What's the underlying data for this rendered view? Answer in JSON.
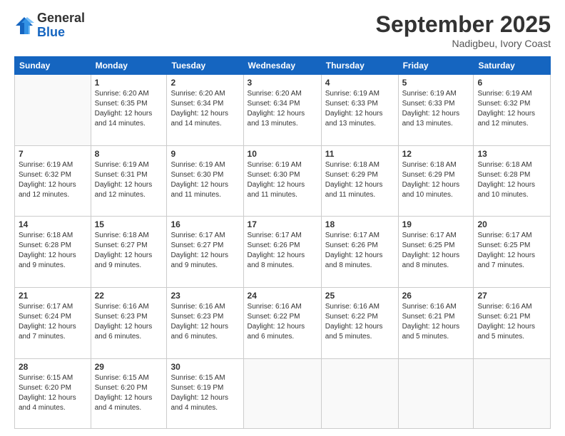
{
  "logo": {
    "general": "General",
    "blue": "Blue"
  },
  "header": {
    "month": "September 2025",
    "location": "Nadigbeu, Ivory Coast"
  },
  "weekdays": [
    "Sunday",
    "Monday",
    "Tuesday",
    "Wednesday",
    "Thursday",
    "Friday",
    "Saturday"
  ],
  "weeks": [
    [
      {
        "day": "",
        "info": ""
      },
      {
        "day": "1",
        "info": "Sunrise: 6:20 AM\nSunset: 6:35 PM\nDaylight: 12 hours\nand 14 minutes."
      },
      {
        "day": "2",
        "info": "Sunrise: 6:20 AM\nSunset: 6:34 PM\nDaylight: 12 hours\nand 14 minutes."
      },
      {
        "day": "3",
        "info": "Sunrise: 6:20 AM\nSunset: 6:34 PM\nDaylight: 12 hours\nand 13 minutes."
      },
      {
        "day": "4",
        "info": "Sunrise: 6:19 AM\nSunset: 6:33 PM\nDaylight: 12 hours\nand 13 minutes."
      },
      {
        "day": "5",
        "info": "Sunrise: 6:19 AM\nSunset: 6:33 PM\nDaylight: 12 hours\nand 13 minutes."
      },
      {
        "day": "6",
        "info": "Sunrise: 6:19 AM\nSunset: 6:32 PM\nDaylight: 12 hours\nand 12 minutes."
      }
    ],
    [
      {
        "day": "7",
        "info": "Sunrise: 6:19 AM\nSunset: 6:32 PM\nDaylight: 12 hours\nand 12 minutes."
      },
      {
        "day": "8",
        "info": "Sunrise: 6:19 AM\nSunset: 6:31 PM\nDaylight: 12 hours\nand 12 minutes."
      },
      {
        "day": "9",
        "info": "Sunrise: 6:19 AM\nSunset: 6:30 PM\nDaylight: 12 hours\nand 11 minutes."
      },
      {
        "day": "10",
        "info": "Sunrise: 6:19 AM\nSunset: 6:30 PM\nDaylight: 12 hours\nand 11 minutes."
      },
      {
        "day": "11",
        "info": "Sunrise: 6:18 AM\nSunset: 6:29 PM\nDaylight: 12 hours\nand 11 minutes."
      },
      {
        "day": "12",
        "info": "Sunrise: 6:18 AM\nSunset: 6:29 PM\nDaylight: 12 hours\nand 10 minutes."
      },
      {
        "day": "13",
        "info": "Sunrise: 6:18 AM\nSunset: 6:28 PM\nDaylight: 12 hours\nand 10 minutes."
      }
    ],
    [
      {
        "day": "14",
        "info": "Sunrise: 6:18 AM\nSunset: 6:28 PM\nDaylight: 12 hours\nand 9 minutes."
      },
      {
        "day": "15",
        "info": "Sunrise: 6:18 AM\nSunset: 6:27 PM\nDaylight: 12 hours\nand 9 minutes."
      },
      {
        "day": "16",
        "info": "Sunrise: 6:17 AM\nSunset: 6:27 PM\nDaylight: 12 hours\nand 9 minutes."
      },
      {
        "day": "17",
        "info": "Sunrise: 6:17 AM\nSunset: 6:26 PM\nDaylight: 12 hours\nand 8 minutes."
      },
      {
        "day": "18",
        "info": "Sunrise: 6:17 AM\nSunset: 6:26 PM\nDaylight: 12 hours\nand 8 minutes."
      },
      {
        "day": "19",
        "info": "Sunrise: 6:17 AM\nSunset: 6:25 PM\nDaylight: 12 hours\nand 8 minutes."
      },
      {
        "day": "20",
        "info": "Sunrise: 6:17 AM\nSunset: 6:25 PM\nDaylight: 12 hours\nand 7 minutes."
      }
    ],
    [
      {
        "day": "21",
        "info": "Sunrise: 6:17 AM\nSunset: 6:24 PM\nDaylight: 12 hours\nand 7 minutes."
      },
      {
        "day": "22",
        "info": "Sunrise: 6:16 AM\nSunset: 6:23 PM\nDaylight: 12 hours\nand 6 minutes."
      },
      {
        "day": "23",
        "info": "Sunrise: 6:16 AM\nSunset: 6:23 PM\nDaylight: 12 hours\nand 6 minutes."
      },
      {
        "day": "24",
        "info": "Sunrise: 6:16 AM\nSunset: 6:22 PM\nDaylight: 12 hours\nand 6 minutes."
      },
      {
        "day": "25",
        "info": "Sunrise: 6:16 AM\nSunset: 6:22 PM\nDaylight: 12 hours\nand 5 minutes."
      },
      {
        "day": "26",
        "info": "Sunrise: 6:16 AM\nSunset: 6:21 PM\nDaylight: 12 hours\nand 5 minutes."
      },
      {
        "day": "27",
        "info": "Sunrise: 6:16 AM\nSunset: 6:21 PM\nDaylight: 12 hours\nand 5 minutes."
      }
    ],
    [
      {
        "day": "28",
        "info": "Sunrise: 6:15 AM\nSunset: 6:20 PM\nDaylight: 12 hours\nand 4 minutes."
      },
      {
        "day": "29",
        "info": "Sunrise: 6:15 AM\nSunset: 6:20 PM\nDaylight: 12 hours\nand 4 minutes."
      },
      {
        "day": "30",
        "info": "Sunrise: 6:15 AM\nSunset: 6:19 PM\nDaylight: 12 hours\nand 4 minutes."
      },
      {
        "day": "",
        "info": ""
      },
      {
        "day": "",
        "info": ""
      },
      {
        "day": "",
        "info": ""
      },
      {
        "day": "",
        "info": ""
      }
    ]
  ]
}
